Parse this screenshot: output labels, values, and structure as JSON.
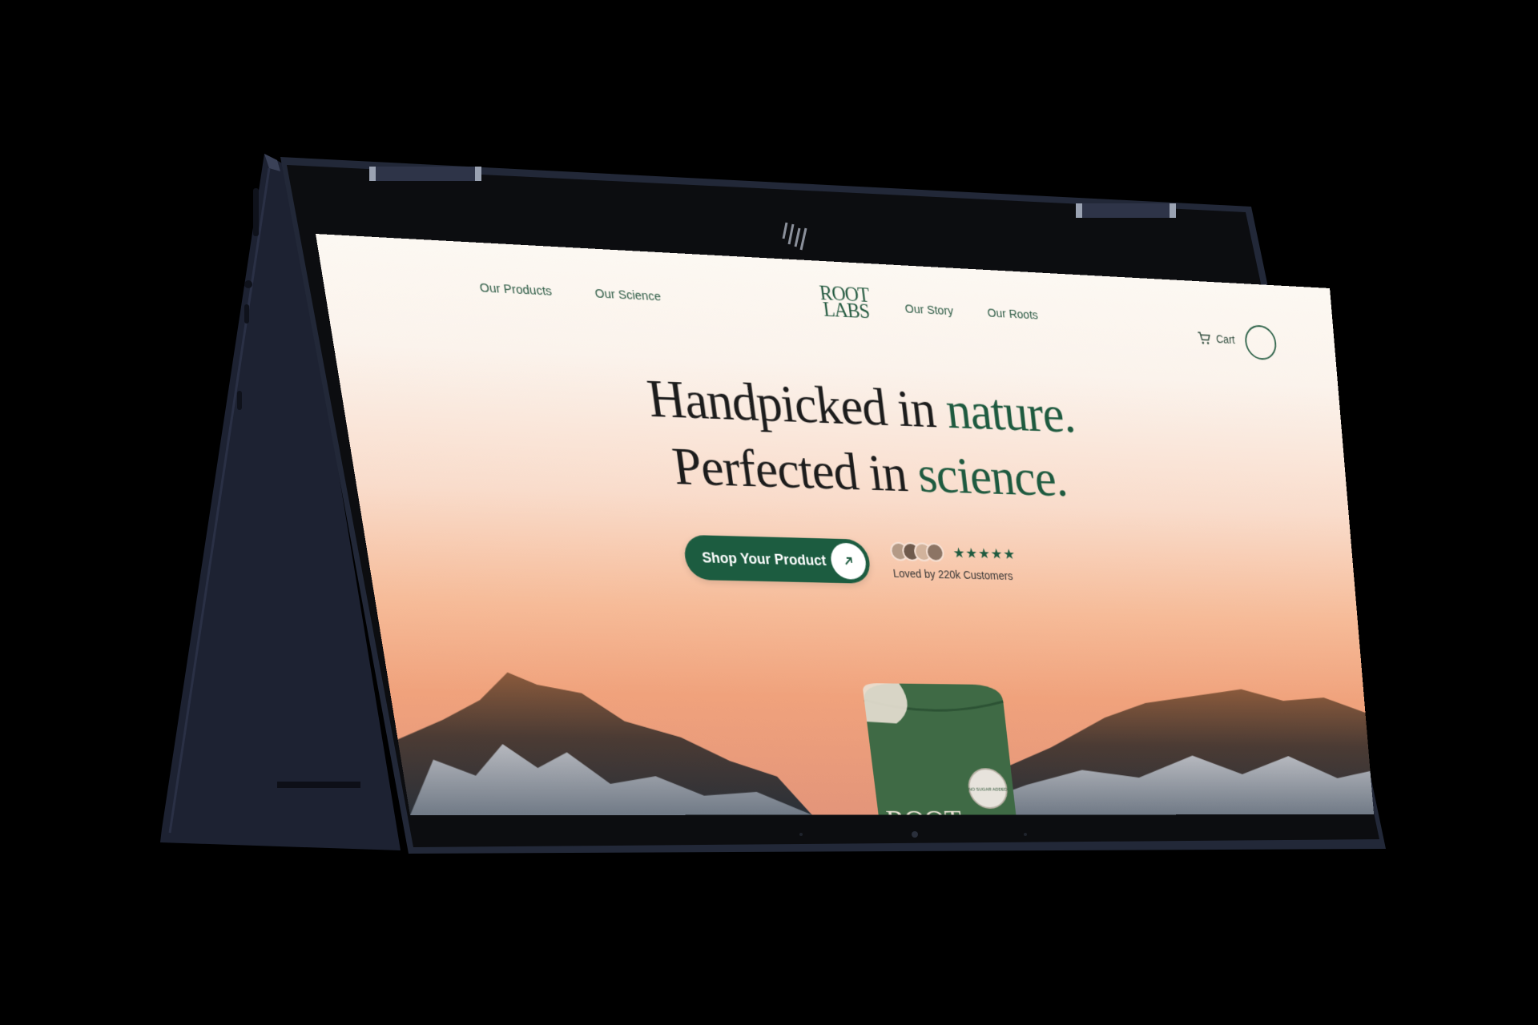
{
  "nav": {
    "left_items": [
      {
        "label": "Our Products"
      },
      {
        "label": "Our Science"
      }
    ],
    "logo": {
      "line1": "ROOT",
      "line2": "LABS"
    },
    "right_items": [
      {
        "label": "Our Story"
      },
      {
        "label": "Our Roots"
      }
    ],
    "cart_label": "Cart"
  },
  "hero": {
    "line1_plain": "Handpicked in ",
    "line1_accent": "nature.",
    "line2_plain": "Perfected in ",
    "line2_accent": "science.",
    "cta_label": "Shop Your Product",
    "rating_stars": "★★★★★",
    "social_proof": "Loved by 220k Customers"
  },
  "product": {
    "brand_text": "ROOT",
    "badge_text": "NO SUGAR ADDED"
  },
  "colors": {
    "accent_green": "#1e5a3f",
    "device_body": "#1d2233",
    "device_bezel": "#0c0d10",
    "background": "#000000"
  },
  "icons": [
    "cart-icon",
    "arrow-up-right-icon",
    "device-brand-logo-icon",
    "webcam-icon"
  ]
}
